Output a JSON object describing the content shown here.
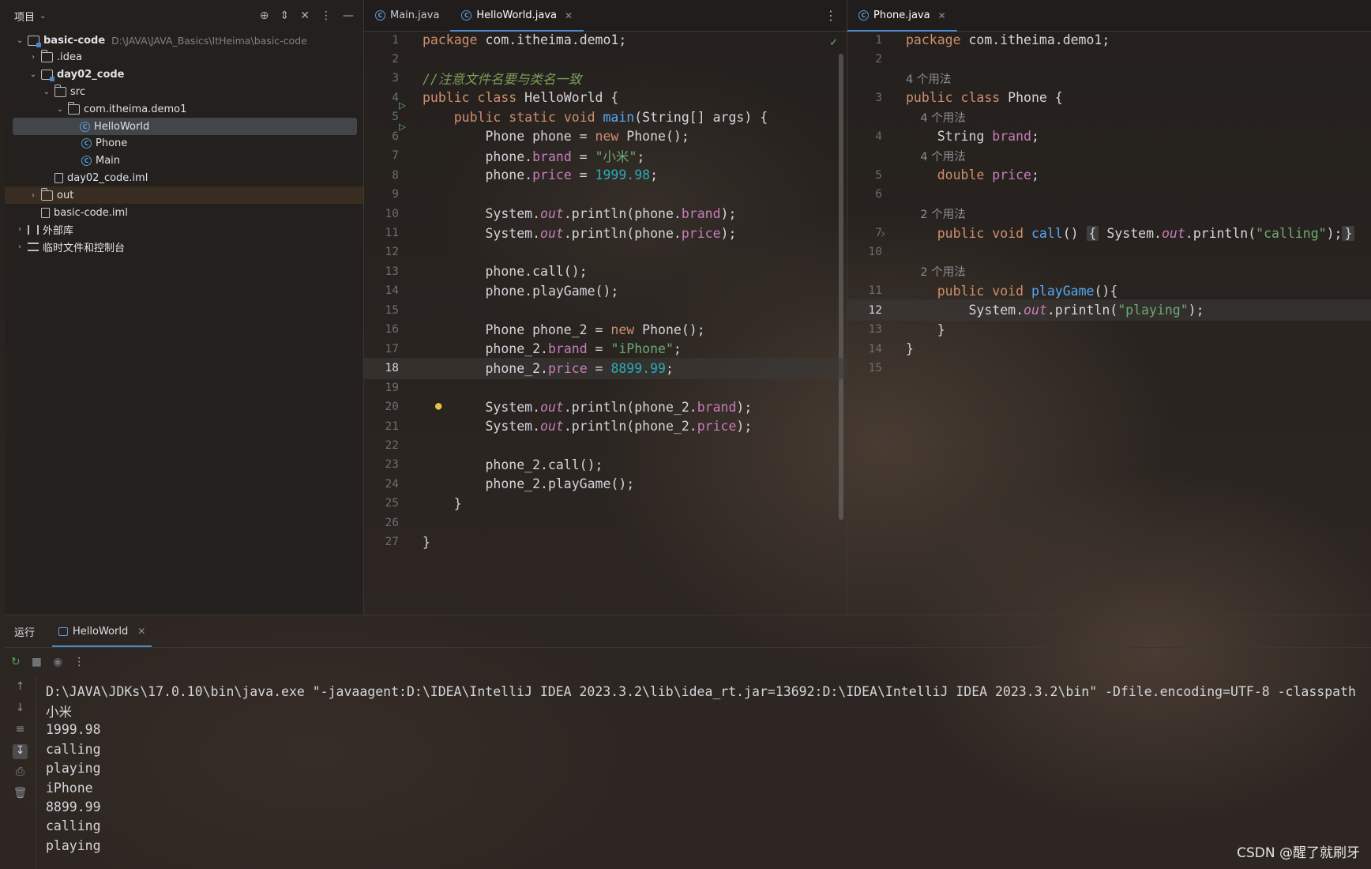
{
  "project": {
    "title": "项目",
    "tree": [
      {
        "label": "basic-code",
        "hint": "D:\\JAVA\\JAVA_Basics\\ItHeima\\basic-code",
        "icon": "module-icon",
        "expanded": true
      },
      {
        "label": ".idea",
        "icon": "folder-icon"
      },
      {
        "label": "day02_code",
        "icon": "module-icon",
        "expanded": true
      },
      {
        "label": "src",
        "icon": "folder-icon",
        "expanded": true
      },
      {
        "label": "com.itheima.demo1",
        "icon": "package-icon",
        "expanded": true
      },
      {
        "label": "HelloWorld",
        "icon": "class-icon",
        "selected": true
      },
      {
        "label": "Phone",
        "icon": "class-icon"
      },
      {
        "label": "Main",
        "icon": "class-icon"
      },
      {
        "label": "day02_code.iml",
        "icon": "file-icon"
      },
      {
        "label": "out",
        "icon": "folder-icon"
      },
      {
        "label": "basic-code.iml",
        "icon": "file-icon"
      },
      {
        "label": "外部库",
        "icon": "library-icon"
      },
      {
        "label": "临时文件和控制台",
        "icon": "scratch-icon"
      }
    ]
  },
  "left_tabs": [
    {
      "label": "Main.java"
    },
    {
      "label": "HelloWorld.java",
      "active": true
    }
  ],
  "right_tabs": [
    {
      "label": "Phone.java",
      "active": true
    }
  ],
  "helloworld": {
    "current_line": 18,
    "lines": [
      {
        "n": "1",
        "segs": [
          [
            "kw",
            "package "
          ],
          [
            "code",
            "com.itheima.demo1;"
          ]
        ]
      },
      {
        "n": "2",
        "segs": []
      },
      {
        "n": "3",
        "segs": [
          [
            "cmt",
            "//注意文件名要与类名一致"
          ]
        ]
      },
      {
        "n": "4",
        "segs": [
          [
            "kw",
            "public class "
          ],
          [
            "code",
            "HelloWorld {"
          ]
        ]
      },
      {
        "n": "5",
        "segs": [
          [
            "code",
            "    "
          ],
          [
            "kw",
            "public static void "
          ],
          [
            "fn",
            "main"
          ],
          [
            "code",
            "(String[] args) {"
          ]
        ]
      },
      {
        "n": "6",
        "segs": [
          [
            "code",
            "        Phone phone = "
          ],
          [
            "kw",
            "new "
          ],
          [
            "code",
            "Phone();"
          ]
        ]
      },
      {
        "n": "7",
        "segs": [
          [
            "code",
            "        phone."
          ],
          [
            "fld",
            "brand"
          ],
          [
            "code",
            " = "
          ],
          [
            "str",
            "\"小米\""
          ],
          [
            "code",
            ";"
          ]
        ]
      },
      {
        "n": "8",
        "segs": [
          [
            "code",
            "        phone."
          ],
          [
            "fld",
            "price"
          ],
          [
            "code",
            " = "
          ],
          [
            "num",
            "1999.98"
          ],
          [
            "code",
            ";"
          ]
        ]
      },
      {
        "n": "9",
        "segs": []
      },
      {
        "n": "10",
        "segs": [
          [
            "code",
            "        System."
          ],
          [
            "static",
            "out"
          ],
          [
            "code",
            ".println(phone."
          ],
          [
            "fld",
            "brand"
          ],
          [
            "code",
            ");"
          ]
        ]
      },
      {
        "n": "11",
        "segs": [
          [
            "code",
            "        System."
          ],
          [
            "static",
            "out"
          ],
          [
            "code",
            ".println(phone."
          ],
          [
            "fld",
            "price"
          ],
          [
            "code",
            ");"
          ]
        ]
      },
      {
        "n": "12",
        "segs": []
      },
      {
        "n": "13",
        "segs": [
          [
            "code",
            "        phone.call();"
          ]
        ]
      },
      {
        "n": "14",
        "segs": [
          [
            "code",
            "        phone.playGame();"
          ]
        ]
      },
      {
        "n": "15",
        "segs": []
      },
      {
        "n": "16",
        "segs": [
          [
            "code",
            "        Phone phone_2 = "
          ],
          [
            "kw",
            "new "
          ],
          [
            "code",
            "Phone();"
          ]
        ]
      },
      {
        "n": "17",
        "segs": [
          [
            "code",
            "        phone_2."
          ],
          [
            "fld",
            "brand"
          ],
          [
            "code",
            " = "
          ],
          [
            "str",
            "\"iPhone\""
          ],
          [
            "code",
            ";"
          ]
        ]
      },
      {
        "n": "18",
        "segs": [
          [
            "code",
            "        phone_2."
          ],
          [
            "fld",
            "price"
          ],
          [
            "code",
            " = "
          ],
          [
            "num",
            "8899.99"
          ],
          [
            "code",
            ";"
          ]
        ]
      },
      {
        "n": "19",
        "segs": []
      },
      {
        "n": "20",
        "segs": [
          [
            "code",
            "        System."
          ],
          [
            "static",
            "out"
          ],
          [
            "code",
            ".println(phone_2."
          ],
          [
            "fld",
            "brand"
          ],
          [
            "code",
            ");"
          ]
        ]
      },
      {
        "n": "21",
        "segs": [
          [
            "code",
            "        System."
          ],
          [
            "static",
            "out"
          ],
          [
            "code",
            ".println(phone_2."
          ],
          [
            "fld",
            "price"
          ],
          [
            "code",
            ");"
          ]
        ]
      },
      {
        "n": "22",
        "segs": []
      },
      {
        "n": "23",
        "segs": [
          [
            "code",
            "        phone_2.call();"
          ]
        ]
      },
      {
        "n": "24",
        "segs": [
          [
            "code",
            "        phone_2.playGame();"
          ]
        ]
      },
      {
        "n": "25",
        "segs": [
          [
            "code",
            "    }"
          ]
        ]
      },
      {
        "n": "26",
        "segs": []
      },
      {
        "n": "27",
        "segs": [
          [
            "code",
            "}"
          ]
        ]
      }
    ]
  },
  "phone": {
    "current_line": "12",
    "lines": [
      {
        "n": "1",
        "segs": [
          [
            "kw",
            "package "
          ],
          [
            "code",
            "com.itheima.demo1;"
          ]
        ]
      },
      {
        "n": "2",
        "segs": []
      },
      {
        "n": "",
        "segs": [
          [
            "hint",
            "4 个用法"
          ]
        ]
      },
      {
        "n": "3",
        "segs": [
          [
            "kw",
            "public class "
          ],
          [
            "code",
            "Phone {"
          ]
        ]
      },
      {
        "n": "",
        "segs": [
          [
            "hint",
            "    4 个用法"
          ]
        ]
      },
      {
        "n": "4",
        "segs": [
          [
            "code",
            "    String "
          ],
          [
            "fld",
            "brand"
          ],
          [
            "code",
            ";"
          ]
        ]
      },
      {
        "n": "",
        "segs": [
          [
            "hint",
            "    4 个用法"
          ]
        ]
      },
      {
        "n": "5",
        "segs": [
          [
            "code",
            "    "
          ],
          [
            "kw",
            "double "
          ],
          [
            "fld",
            "price"
          ],
          [
            "code",
            ";"
          ]
        ]
      },
      {
        "n": "6",
        "segs": []
      },
      {
        "n": "",
        "segs": [
          [
            "hint",
            "    2 个用法"
          ]
        ]
      },
      {
        "n": "7",
        "segs": [
          [
            "code",
            "    "
          ],
          [
            "kw",
            "public void "
          ],
          [
            "fn",
            "call"
          ],
          [
            "code",
            "() "
          ],
          [
            "folded",
            "{"
          ],
          [
            "code",
            " System."
          ],
          [
            "static",
            "out"
          ],
          [
            "code",
            ".println("
          ],
          [
            "str",
            "\"calling\""
          ],
          [
            "code",
            ");"
          ],
          [
            "folded",
            "}"
          ]
        ]
      },
      {
        "n": "10",
        "segs": []
      },
      {
        "n": "",
        "segs": [
          [
            "hint",
            "    2 个用法"
          ]
        ]
      },
      {
        "n": "11",
        "segs": [
          [
            "code",
            "    "
          ],
          [
            "kw",
            "public void "
          ],
          [
            "fn",
            "playGame"
          ],
          [
            "code",
            "(){"
          ]
        ]
      },
      {
        "n": "12",
        "segs": [
          [
            "code",
            "        System."
          ],
          [
            "static",
            "out"
          ],
          [
            "code",
            ".println("
          ],
          [
            "str",
            "\"playing\""
          ],
          [
            "code",
            ");"
          ]
        ]
      },
      {
        "n": "13",
        "segs": [
          [
            "code",
            "    }"
          ]
        ]
      },
      {
        "n": "14",
        "segs": [
          [
            "code",
            "}"
          ]
        ]
      },
      {
        "n": "15",
        "segs": []
      }
    ]
  },
  "run": {
    "title": "运行",
    "tab": "HelloWorld",
    "output": [
      "D:\\JAVA\\JDKs\\17.0.10\\bin\\java.exe \"-javaagent:D:\\IDEA\\IntelliJ IDEA 2023.3.2\\lib\\idea_rt.jar=13692:D:\\IDEA\\IntelliJ IDEA 2023.3.2\\bin\" -Dfile.encoding=UTF-8 -classpath",
      "小米",
      "1999.98",
      "calling",
      "playing",
      "iPhone",
      "8899.99",
      "calling",
      "playing"
    ]
  },
  "watermark": "CSDN @醒了就刷牙",
  "colors": {
    "accent": "#4a88c7",
    "keyword": "#cf8e6d",
    "field": "#c77dbb",
    "string": "#6aab73",
    "number": "#2aacb8",
    "comment": "#7a9e58"
  }
}
